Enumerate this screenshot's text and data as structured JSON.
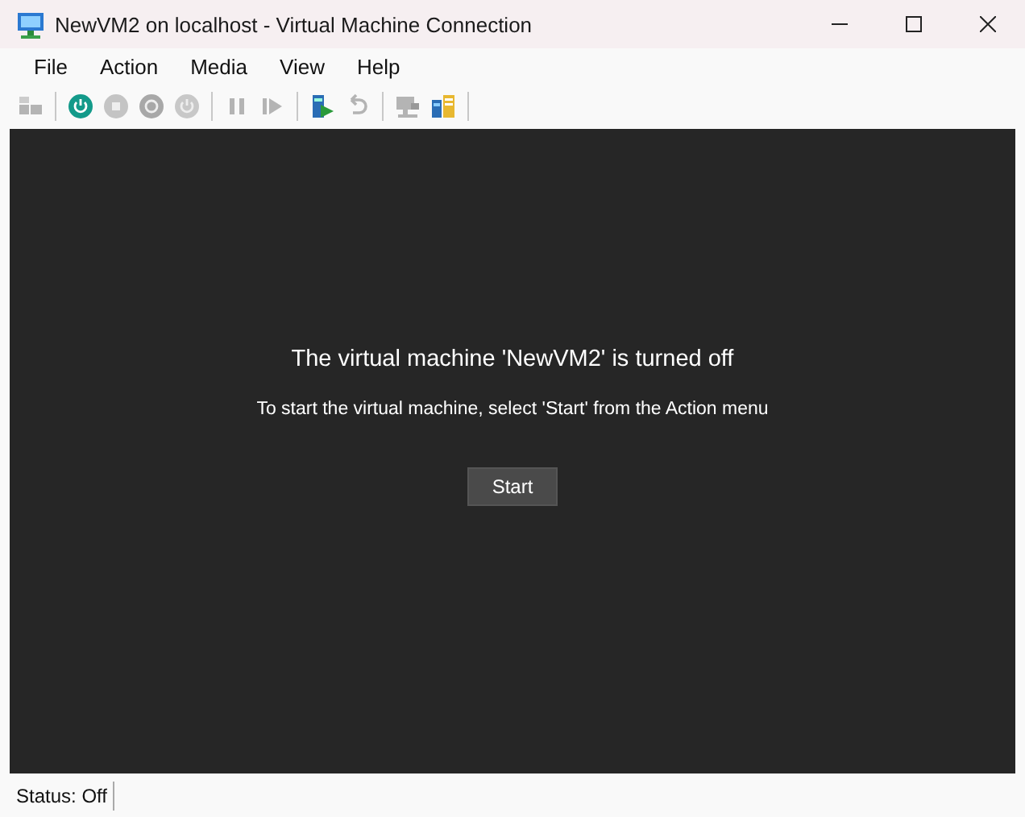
{
  "window": {
    "title": "NewVM2 on localhost - Virtual Machine Connection"
  },
  "menu": [
    "File",
    "Action",
    "Media",
    "View",
    "Help"
  ],
  "toolbar": [
    [
      {
        "kind": "ctrlaltdel",
        "disabled": true
      }
    ],
    [
      {
        "kind": "start",
        "disabled": false
      },
      {
        "kind": "turnoff",
        "disabled": true
      },
      {
        "kind": "shutdown",
        "disabled": true
      },
      {
        "kind": "save",
        "disabled": true
      }
    ],
    [
      {
        "kind": "pause",
        "disabled": true
      },
      {
        "kind": "resume",
        "disabled": true
      }
    ],
    [
      {
        "kind": "checkpoint",
        "disabled": false
      },
      {
        "kind": "revert",
        "disabled": true
      }
    ],
    [
      {
        "kind": "session",
        "disabled": true
      },
      {
        "kind": "share",
        "disabled": false
      }
    ]
  ],
  "screen": {
    "heading": "The virtual machine 'NewVM2' is turned off",
    "message": "To start the virtual machine, select 'Start' from the Action menu",
    "button": "Start"
  },
  "status_bar": {
    "text": "Status: Off"
  }
}
